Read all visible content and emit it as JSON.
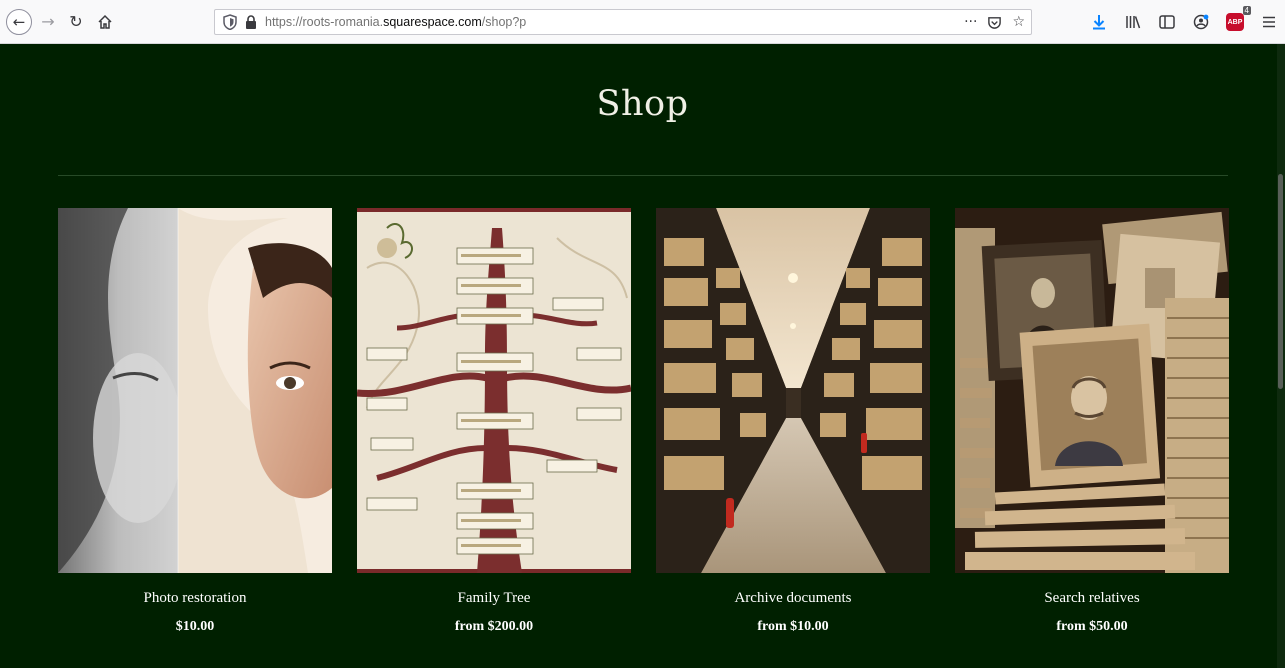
{
  "browser": {
    "url_prefix": "https://roots-romania.",
    "url_domain": "squarespace.com",
    "url_suffix": "/shop?p",
    "more_glyph": "···",
    "abp_label": "ABP",
    "abp_badge": "4"
  },
  "page": {
    "title": "Shop"
  },
  "products": [
    {
      "name": "Photo restoration",
      "price": "$10.00"
    },
    {
      "name": "Family Tree",
      "price": "from $200.00"
    },
    {
      "name": "Archive documents",
      "price": "from $10.00"
    },
    {
      "name": "Search relatives",
      "price": "from $50.00"
    }
  ],
  "colors": {
    "page_background": "#002000",
    "text": "#ffffff",
    "download_accent": "#0a84ff",
    "abp_red": "#c70d2c"
  },
  "icons": [
    "back-icon",
    "forward-icon",
    "reload-icon",
    "home-icon",
    "shield-icon",
    "lock-icon",
    "more-icon",
    "pocket-icon",
    "bookmark-star-icon",
    "download-icon",
    "library-icon",
    "sidebar-icon",
    "account-icon",
    "adblock-icon",
    "menu-icon"
  ]
}
